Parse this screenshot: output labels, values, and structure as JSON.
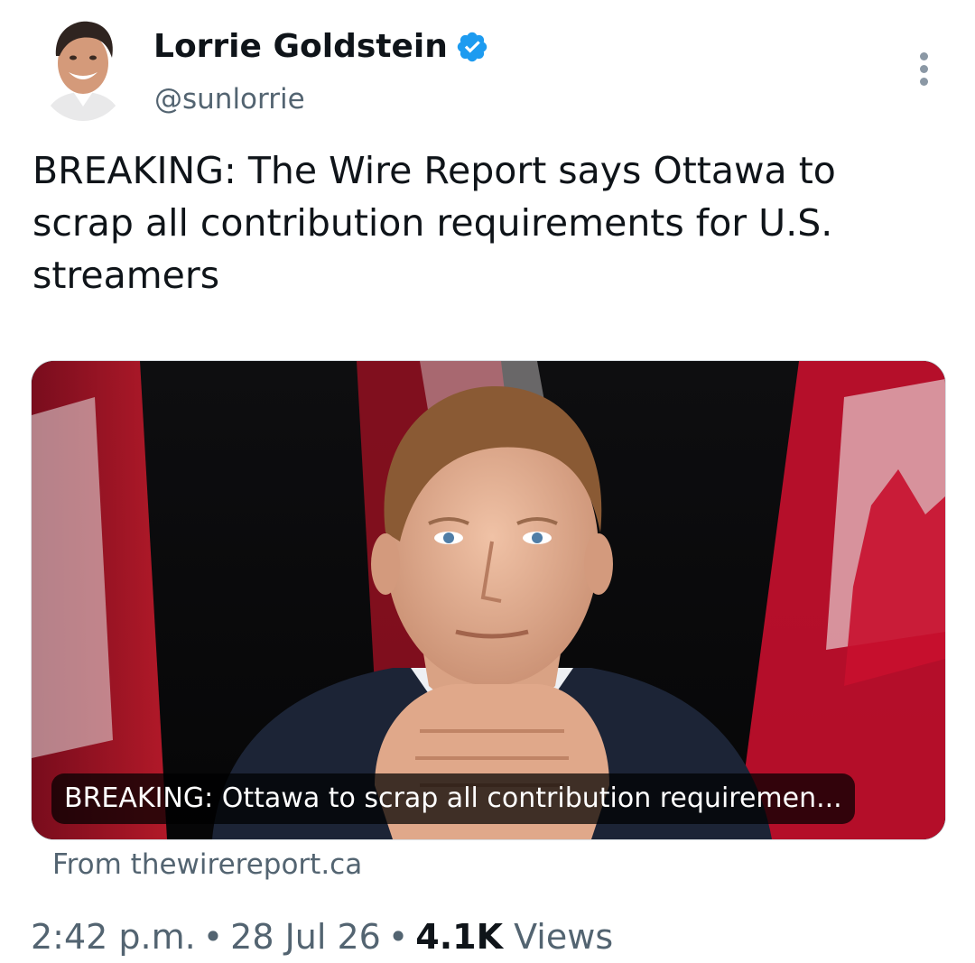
{
  "author": {
    "name": "Lorrie Goldstein",
    "handle": "@sunlorrie",
    "verified": true,
    "avatar_icon": "author-avatar-photo",
    "verified_icon": "verified-badge-icon",
    "verified_color": "#1d9bf0"
  },
  "tweet": {
    "text": "BREAKING: The Wire Report says Ottawa to\nscrap all contribution requirements for U.S.\nstreamers"
  },
  "link_card": {
    "caption": "BREAKING: Ottawa to scrap all contribution requiremen...",
    "source": "From thewirereport.ca"
  },
  "meta": {
    "time": "2:42 p.m.",
    "separator": "•",
    "date": "28 Jul 26",
    "views_count": "4.1K",
    "views_label": "Views"
  },
  "colors": {
    "text_primary": "#0f1419",
    "text_secondary": "#536471",
    "flag_red": "#c8102e"
  },
  "icons": {
    "more": "more-options-icon"
  }
}
